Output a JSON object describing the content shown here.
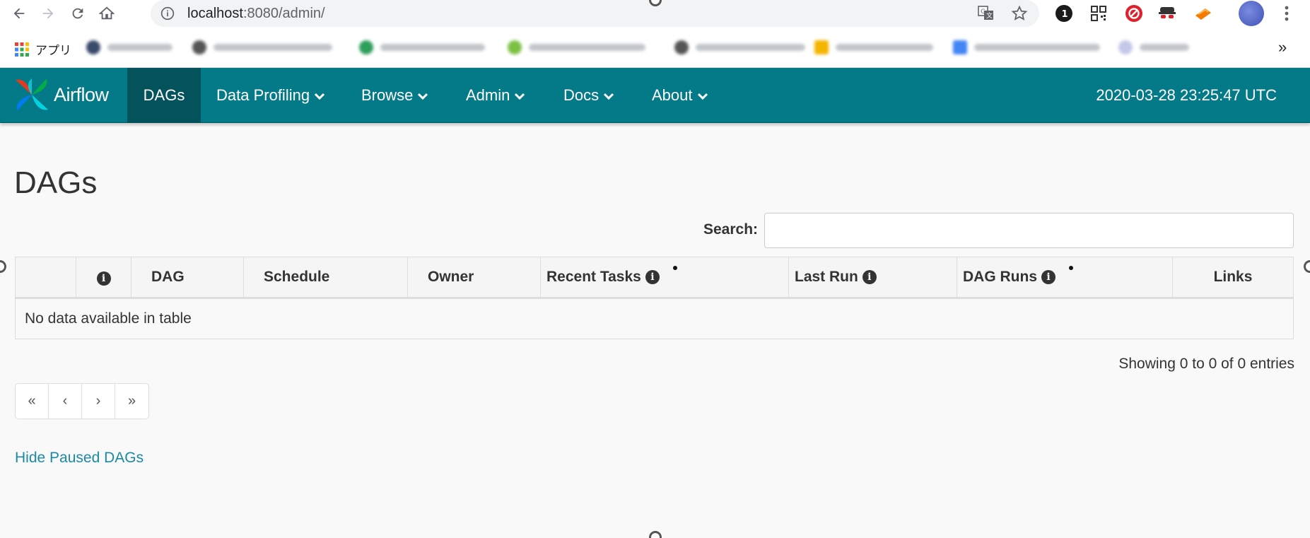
{
  "browser": {
    "url_host": "localhost",
    "url_rest": ":8080/admin/",
    "apps_label": "アプリ",
    "bookmarks_more": "»"
  },
  "navbar": {
    "brand": "Airflow",
    "items": [
      {
        "label": "DAGs",
        "active": true
      },
      {
        "label": "Data Profiling"
      },
      {
        "label": "Browse"
      },
      {
        "label": "Admin"
      },
      {
        "label": "Docs"
      },
      {
        "label": "About"
      }
    ],
    "datetime": "2020-03-28 23:25:47 UTC"
  },
  "page": {
    "title": "DAGs",
    "search_label": "Search:",
    "search_value": ""
  },
  "table": {
    "columns": [
      "",
      "",
      "DAG",
      "Schedule",
      "Owner",
      "Recent Tasks",
      "Last Run",
      "DAG Runs",
      "Links"
    ],
    "empty_message": "No data available in table",
    "info": "Showing 0 to 0 of 0 entries"
  },
  "pagination": {
    "first": "«",
    "prev": "‹",
    "next": "›",
    "last": "»"
  },
  "links": {
    "hide_paused": "Hide Paused DAGs"
  },
  "colors": {
    "navbar": "#047a88",
    "navbar_active": "#04535c",
    "link": "#1d89a3"
  }
}
